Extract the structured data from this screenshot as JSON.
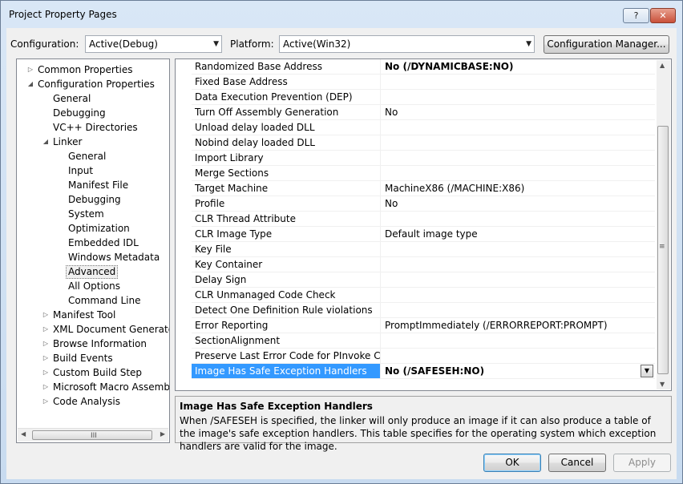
{
  "window": {
    "title": "Project Property Pages",
    "help_label": "?",
    "close_label": "✕"
  },
  "config": {
    "configuration_label": "Configuration:",
    "configuration_value": "Active(Debug)",
    "platform_label": "Platform:",
    "platform_value": "Active(Win32)",
    "manager_label": "Configuration Manager..."
  },
  "tree": {
    "items": [
      {
        "label": "Common Properties",
        "exp": "▷"
      },
      {
        "label": "Configuration Properties",
        "exp": "◢"
      },
      {
        "label": "General",
        "exp": ""
      },
      {
        "label": "Debugging",
        "exp": ""
      },
      {
        "label": "VC++ Directories",
        "exp": ""
      },
      {
        "label": "Linker",
        "exp": "◢"
      },
      {
        "label": "General",
        "exp": ""
      },
      {
        "label": "Input",
        "exp": ""
      },
      {
        "label": "Manifest File",
        "exp": ""
      },
      {
        "label": "Debugging",
        "exp": ""
      },
      {
        "label": "System",
        "exp": ""
      },
      {
        "label": "Optimization",
        "exp": ""
      },
      {
        "label": "Embedded IDL",
        "exp": ""
      },
      {
        "label": "Windows Metadata",
        "exp": ""
      },
      {
        "label": "Advanced",
        "exp": ""
      },
      {
        "label": "All Options",
        "exp": ""
      },
      {
        "label": "Command Line",
        "exp": ""
      },
      {
        "label": "Manifest Tool",
        "exp": "▷"
      },
      {
        "label": "XML Document Generator",
        "exp": "▷"
      },
      {
        "label": "Browse Information",
        "exp": "▷"
      },
      {
        "label": "Build Events",
        "exp": "▷"
      },
      {
        "label": "Custom Build Step",
        "exp": "▷"
      },
      {
        "label": "Microsoft Macro Assembler",
        "exp": "▷"
      },
      {
        "label": "Code Analysis",
        "exp": "▷"
      }
    ],
    "scroll_left": "◀",
    "scroll_right": "▶",
    "scroll_grip": "III"
  },
  "grid": {
    "rows": [
      {
        "name": "Randomized Base Address",
        "value": "No (/DYNAMICBASE:NO)"
      },
      {
        "name": "Fixed Base Address",
        "value": ""
      },
      {
        "name": "Data Execution Prevention (DEP)",
        "value": ""
      },
      {
        "name": "Turn Off Assembly Generation",
        "value": "No"
      },
      {
        "name": "Unload delay loaded DLL",
        "value": ""
      },
      {
        "name": "Nobind delay loaded DLL",
        "value": ""
      },
      {
        "name": "Import Library",
        "value": ""
      },
      {
        "name": "Merge Sections",
        "value": ""
      },
      {
        "name": "Target Machine",
        "value": "MachineX86 (/MACHINE:X86)"
      },
      {
        "name": "Profile",
        "value": "No"
      },
      {
        "name": "CLR Thread Attribute",
        "value": ""
      },
      {
        "name": "CLR Image Type",
        "value": "Default image type"
      },
      {
        "name": "Key File",
        "value": ""
      },
      {
        "name": "Key Container",
        "value": ""
      },
      {
        "name": "Delay Sign",
        "value": ""
      },
      {
        "name": "CLR Unmanaged Code Check",
        "value": ""
      },
      {
        "name": "Detect One Definition Rule violations",
        "value": ""
      },
      {
        "name": "Error Reporting",
        "value": "PromptImmediately (/ERRORREPORT:PROMPT)"
      },
      {
        "name": "SectionAlignment",
        "value": ""
      },
      {
        "name": "Preserve Last Error Code for PInvoke Calls",
        "value": ""
      },
      {
        "name": "Image Has Safe Exception Handlers",
        "value": "No (/SAFESEH:NO)"
      }
    ],
    "dropdown_arrow": "▼",
    "scroll_up": "▲",
    "scroll_down": "▼",
    "scroll_grip": "≡"
  },
  "description": {
    "title": "Image Has Safe Exception Handlers",
    "text": "When /SAFESEH is specified, the linker will only produce an image if it can also produce a table of the image's safe exception handlers. This table specifies for the operating system which exception handlers are valid for the image."
  },
  "buttons": {
    "ok": "OK",
    "cancel": "Cancel",
    "apply": "Apply"
  },
  "colors": {
    "selection": "#3399ff"
  }
}
